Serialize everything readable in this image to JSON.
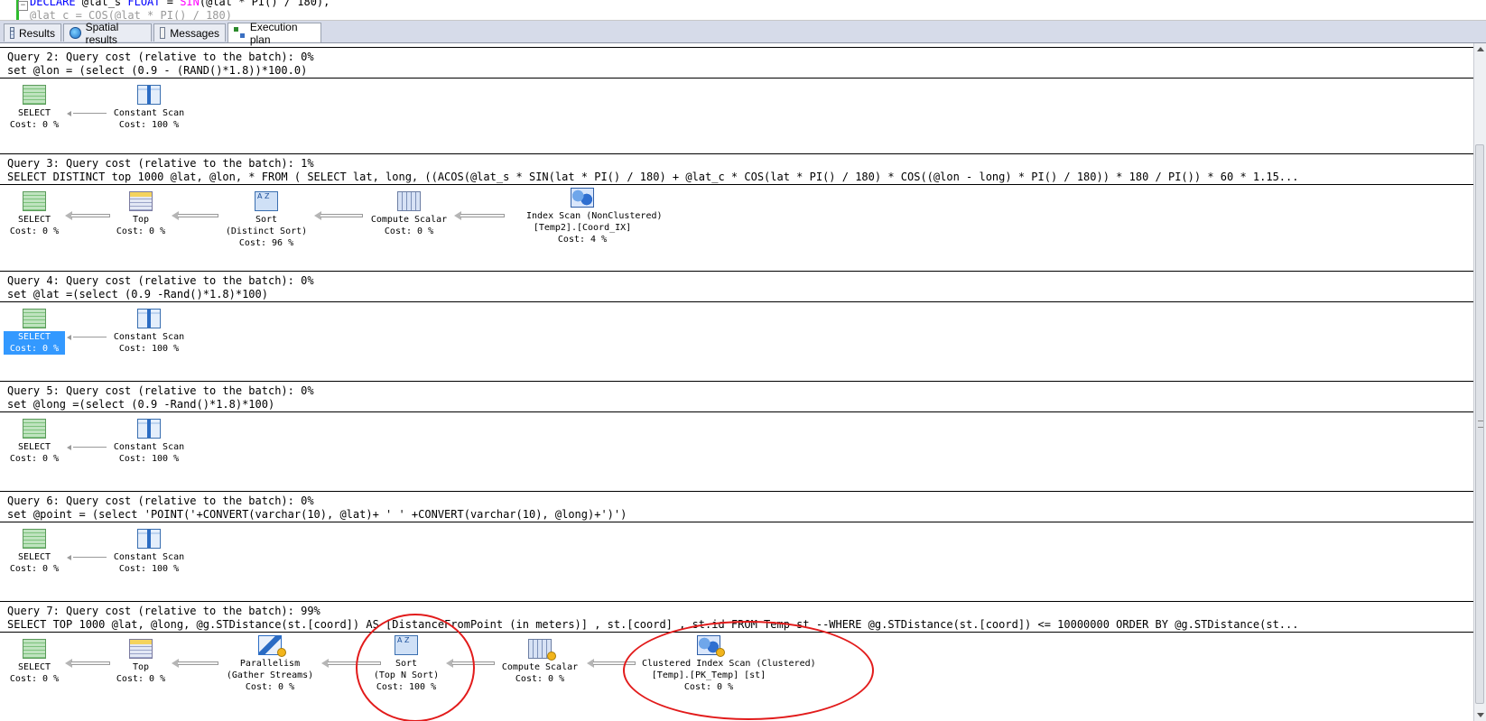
{
  "editor": {
    "line1_kw1": "DECLARE",
    "line1_var": " @lat_s ",
    "line1_kw2": "FLOAT",
    "line1_eq": " = ",
    "line1_fn": "SIN",
    "line1_rest": "(@lat * PI() / 180),",
    "line2": "@lat_c = COS(@lat * PI() / 180)"
  },
  "tabs": [
    {
      "label": "Results",
      "icon": "grid-icon"
    },
    {
      "label": "Spatial results",
      "icon": "globe-icon"
    },
    {
      "label": "Messages",
      "icon": "messages-icon"
    },
    {
      "label": "Execution plan",
      "icon": "execution-plan-icon",
      "active": true
    }
  ],
  "queries": [
    {
      "header": "Query 2: Query cost (relative to the batch): 0%",
      "sql": "set @lon = (select (0.9 - (RAND()*1.8))*100.0)",
      "nodes": [
        {
          "name": "SELECT",
          "cost": "Cost: 0 %"
        },
        {
          "name": "Constant Scan",
          "cost": "Cost: 100 %"
        }
      ]
    },
    {
      "header": "Query 3: Query cost (relative to the batch): 1%",
      "sql": "SELECT DISTINCT top 1000 @lat, @lon, * FROM ( SELECT lat, long, ((ACOS(@lat_s * SIN(lat * PI() / 180) + @lat_c * COS(lat * PI() / 180) * COS((@lon - long) * PI() / 180)) * 180 / PI()) * 60 * 1.15...",
      "nodes": [
        {
          "name": "SELECT",
          "cost": "Cost: 0 %"
        },
        {
          "name": "Top",
          "cost": "Cost: 0 %"
        },
        {
          "name": "Sort",
          "sub": "(Distinct Sort)",
          "cost": "Cost: 96 %"
        },
        {
          "name": "Compute Scalar",
          "cost": "Cost: 0 %"
        },
        {
          "name": "Index Scan (NonClustered)",
          "sub": "[Temp2].[Coord_IX]",
          "cost": "Cost: 4 %"
        }
      ]
    },
    {
      "header": "Query 4: Query cost (relative to the batch): 0%",
      "sql": "set @lat =(select (0.9 -Rand()*1.8)*100)",
      "nodes": [
        {
          "name": "SELECT",
          "cost": "Cost: 0 %"
        },
        {
          "name": "Constant Scan",
          "cost": "Cost: 100 %"
        }
      ]
    },
    {
      "header": "Query 5: Query cost (relative to the batch): 0%",
      "sql": "set @long =(select (0.9 -Rand()*1.8)*100)",
      "nodes": [
        {
          "name": "SELECT",
          "cost": "Cost: 0 %"
        },
        {
          "name": "Constant Scan",
          "cost": "Cost: 100 %"
        }
      ]
    },
    {
      "header": "Query 6: Query cost (relative to the batch): 0%",
      "sql": "set @point = (select 'POINT('+CONVERT(varchar(10), @lat)+ ' ' +CONVERT(varchar(10), @long)+')')",
      "nodes": [
        {
          "name": "SELECT",
          "cost": "Cost: 0 %"
        },
        {
          "name": "Constant Scan",
          "cost": "Cost: 100 %"
        }
      ]
    },
    {
      "header": "Query 7: Query cost (relative to the batch): 99%",
      "sql": "SELECT TOP 1000 @lat, @long, @g.STDistance(st.[coord]) AS [DistanceFromPoint (in meters)] , st.[coord] , st.id FROM Temp st --WHERE @g.STDistance(st.[coord]) <= 10000000 ORDER BY @g.STDistance(st...",
      "nodes": [
        {
          "name": "SELECT",
          "cost": "Cost: 0 %"
        },
        {
          "name": "Top",
          "cost": "Cost: 0 %"
        },
        {
          "name": "Parallelism",
          "sub": "(Gather Streams)",
          "cost": "Cost: 0 %"
        },
        {
          "name": "Sort",
          "sub": "(Top N Sort)",
          "cost": "Cost: 100 %"
        },
        {
          "name": "Compute Scalar",
          "cost": "Cost: 0 %"
        },
        {
          "name": "Clustered Index Scan (Clustered)",
          "sub": "[Temp].[PK_Temp] [st]",
          "cost": "Cost: 0 %"
        }
      ]
    }
  ],
  "icons": {
    "select": "select-icon",
    "top": "top-icon",
    "sort": "sort-icon",
    "compute_scalar": "compute-scalar-icon",
    "index_scan": "index-scan-icon",
    "constant_scan": "constant-scan-icon",
    "parallelism": "parallelism-icon"
  },
  "sort_icon_glyph": "A Z",
  "colors": {
    "highlight": "#3399ff",
    "annotation": "#e21b1b",
    "keyword": "#0000ff",
    "function": "#ff00ff"
  }
}
